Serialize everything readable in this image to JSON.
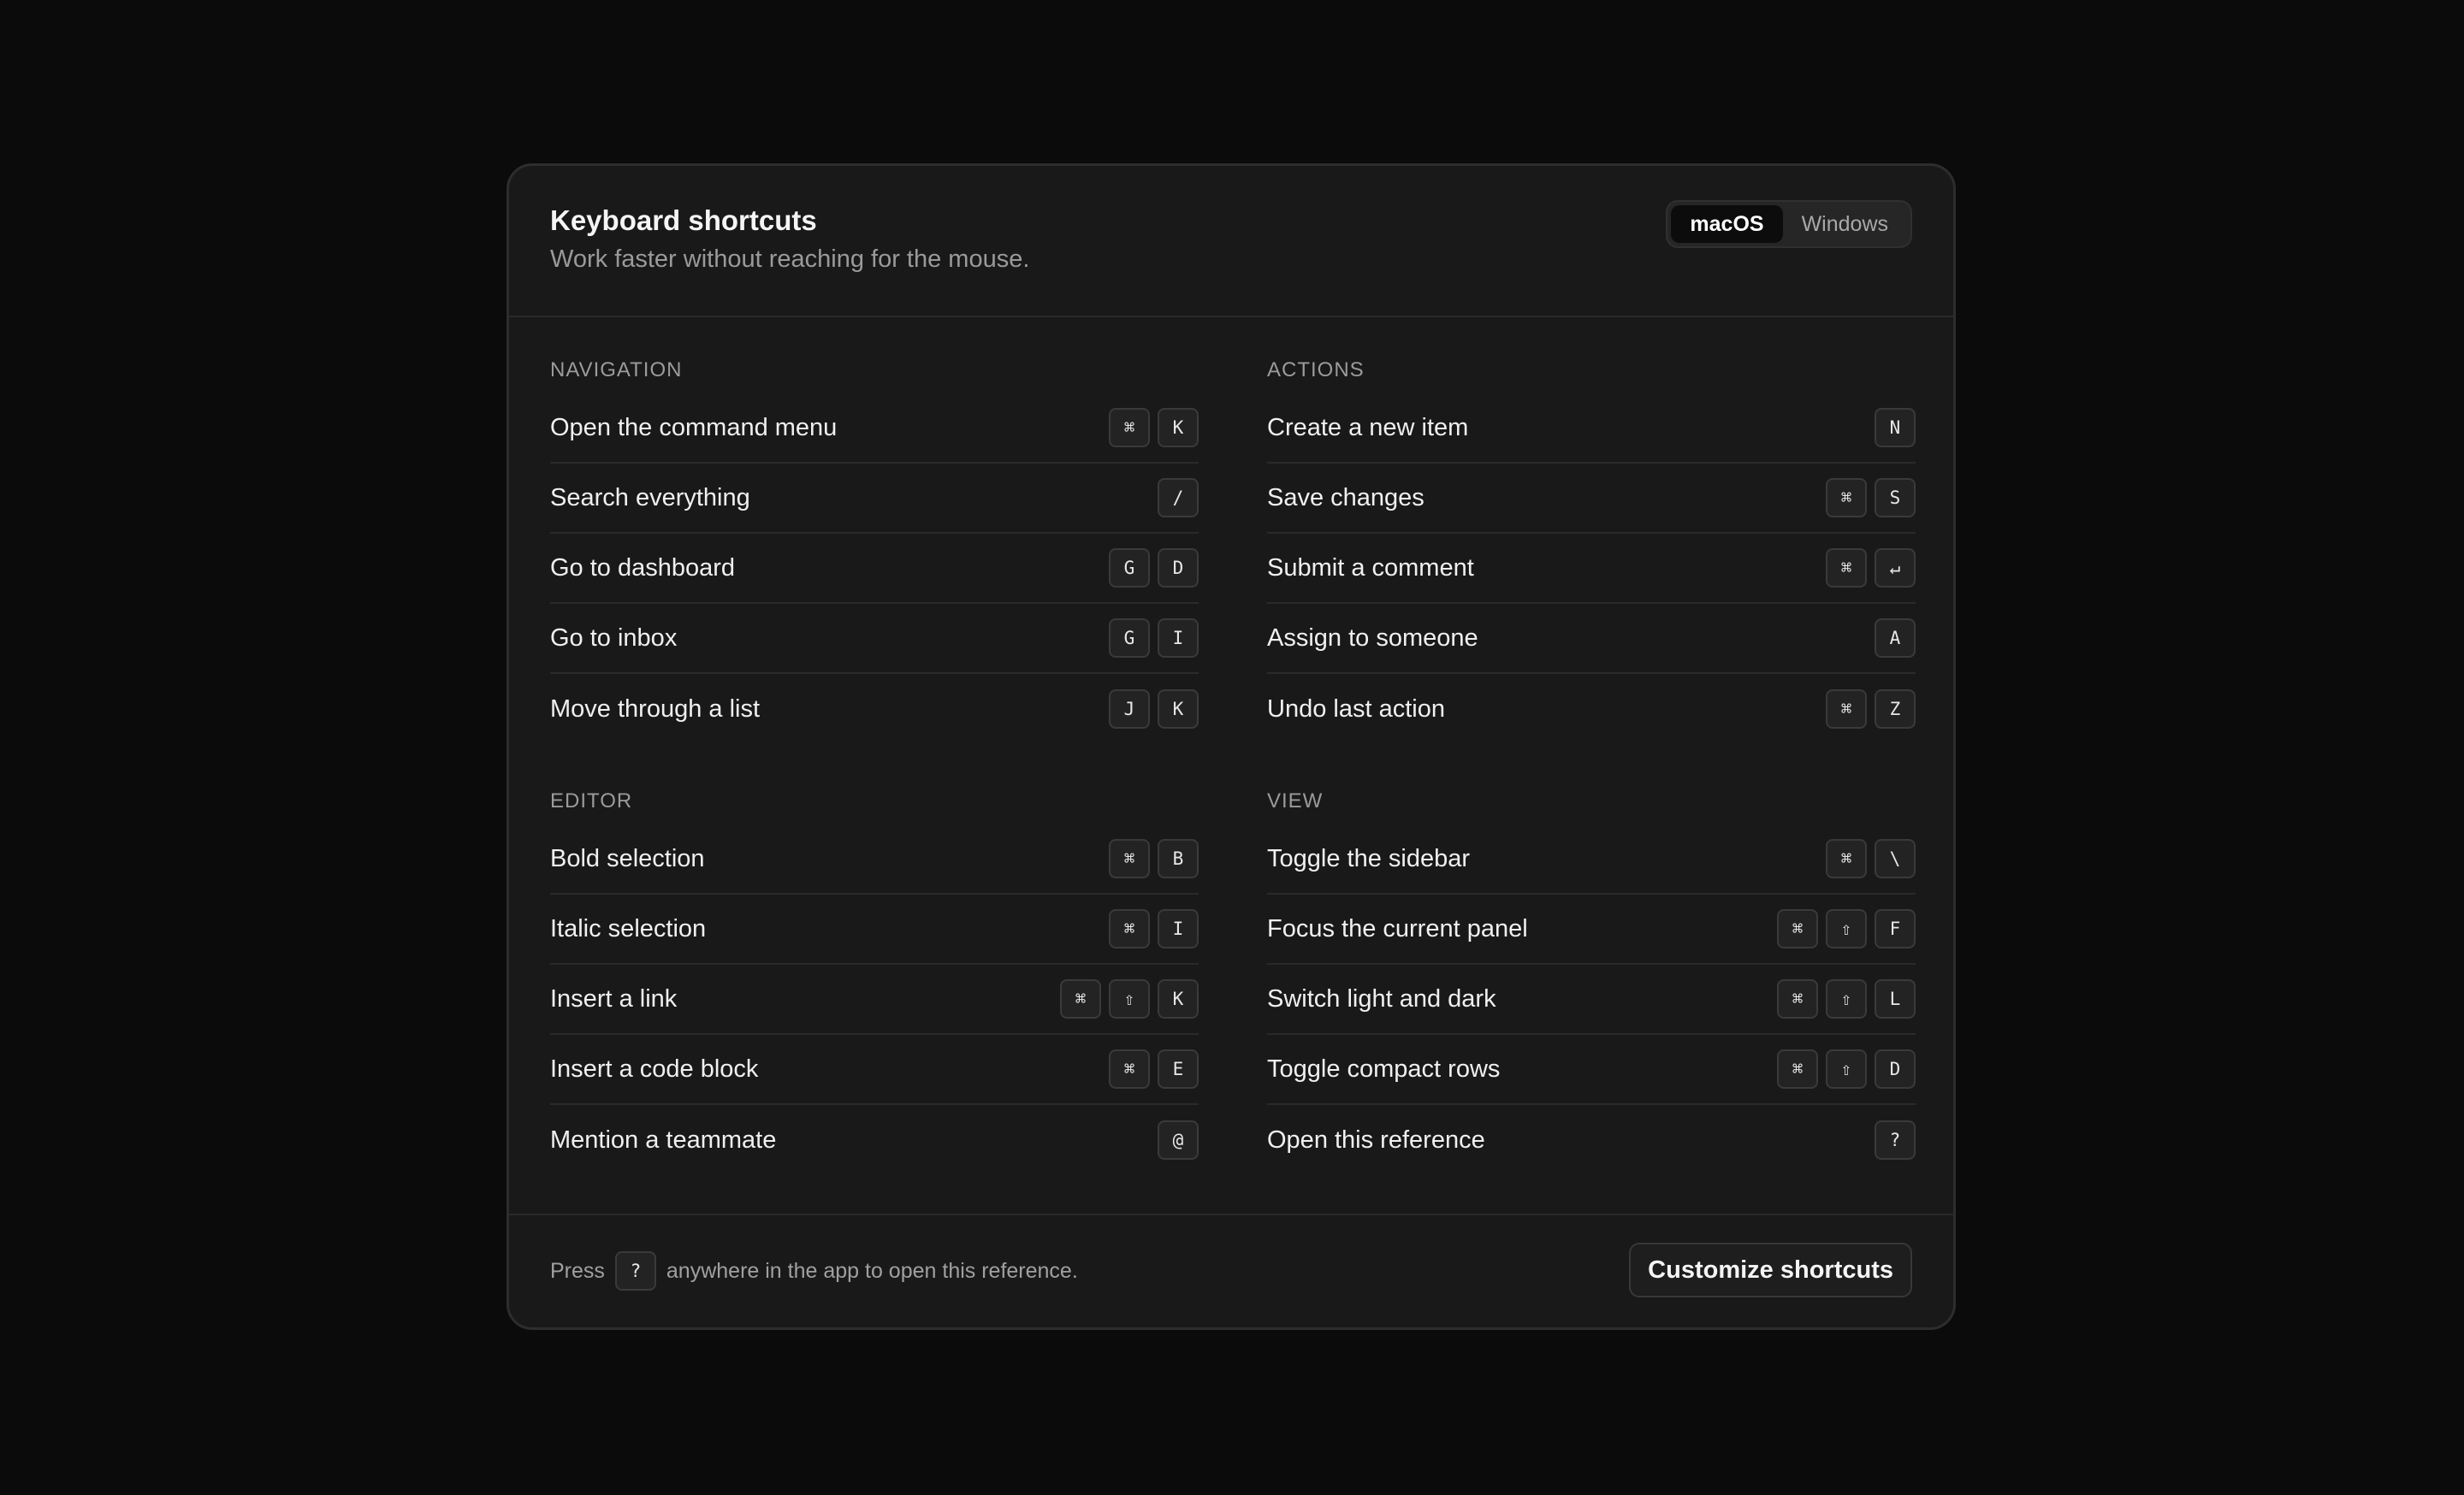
{
  "header": {
    "title": "Keyboard shortcuts",
    "subtitle": "Work faster without reaching for the mouse.",
    "os_options": [
      "macOS",
      "Windows"
    ],
    "os_selected": "macOS"
  },
  "sections": {
    "navigation": {
      "title": "NAVIGATION",
      "rows": [
        {
          "label": "Open the command menu",
          "keys": [
            "⌘",
            "K"
          ]
        },
        {
          "label": "Search everything",
          "keys": [
            "/"
          ]
        },
        {
          "label": "Go to dashboard",
          "keys": [
            "G",
            "D"
          ]
        },
        {
          "label": "Go to inbox",
          "keys": [
            "G",
            "I"
          ]
        },
        {
          "label": "Move through a list",
          "keys": [
            "J",
            "K"
          ]
        }
      ]
    },
    "actions": {
      "title": "ACTIONS",
      "rows": [
        {
          "label": "Create a new item",
          "keys": [
            "N"
          ]
        },
        {
          "label": "Save changes",
          "keys": [
            "⌘",
            "S"
          ]
        },
        {
          "label": "Submit a comment",
          "keys": [
            "⌘",
            "↵"
          ]
        },
        {
          "label": "Assign to someone",
          "keys": [
            "A"
          ]
        },
        {
          "label": "Undo last action",
          "keys": [
            "⌘",
            "Z"
          ]
        }
      ]
    },
    "editor": {
      "title": "EDITOR",
      "rows": [
        {
          "label": "Bold selection",
          "keys": [
            "⌘",
            "B"
          ]
        },
        {
          "label": "Italic selection",
          "keys": [
            "⌘",
            "I"
          ]
        },
        {
          "label": "Insert a link",
          "keys": [
            "⌘",
            "⇧",
            "K"
          ]
        },
        {
          "label": "Insert a code block",
          "keys": [
            "⌘",
            "E"
          ]
        },
        {
          "label": "Mention a teammate",
          "keys": [
            "@"
          ]
        }
      ]
    },
    "view": {
      "title": "VIEW",
      "rows": [
        {
          "label": "Toggle the sidebar",
          "keys": [
            "⌘",
            "\\"
          ]
        },
        {
          "label": "Focus the current panel",
          "keys": [
            "⌘",
            "⇧",
            "F"
          ]
        },
        {
          "label": "Switch light and dark",
          "keys": [
            "⌘",
            "⇧",
            "L"
          ]
        },
        {
          "label": "Toggle compact rows",
          "keys": [
            "⌘",
            "⇧",
            "D"
          ]
        },
        {
          "label": "Open this reference",
          "keys": [
            "?"
          ]
        }
      ]
    }
  },
  "footer": {
    "note_prefix": "Press",
    "note_key": "?",
    "note_suffix": "anywhere in the app to open this reference.",
    "customize_label": "Customize shortcuts"
  }
}
